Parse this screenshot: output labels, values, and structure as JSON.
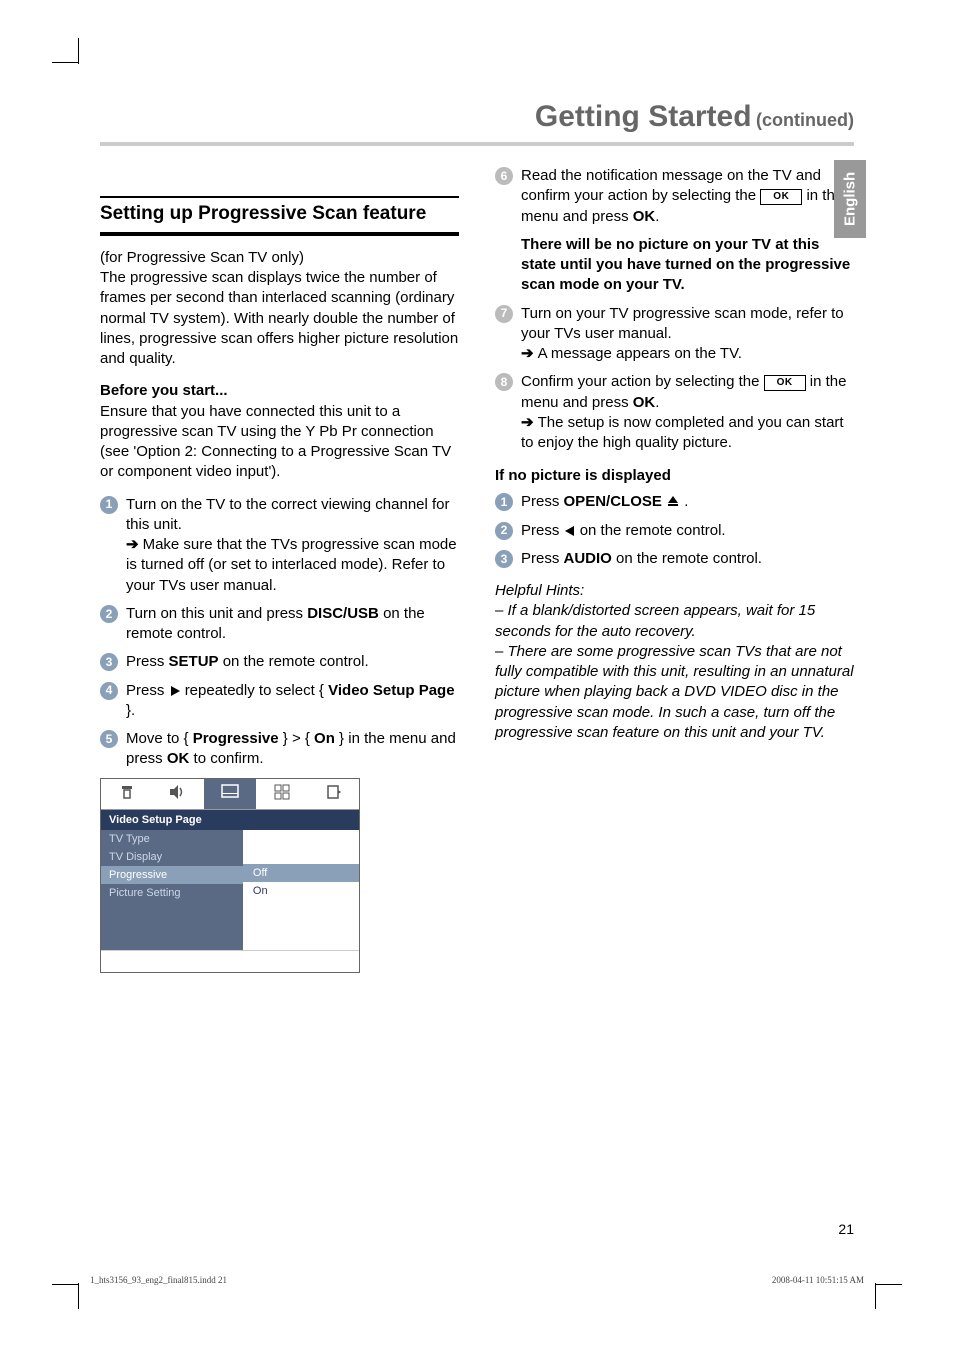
{
  "title": {
    "main": "Getting Started",
    "cont": "(continued)"
  },
  "side_tab": "English",
  "page_number": "21",
  "print": {
    "left": "1_hts3156_93_eng2_final815.indd   21",
    "right": "2008-04-11   10:51:15 AM"
  },
  "left": {
    "section_heading": "Setting up Progressive Scan feature",
    "intro": "(for Progressive Scan TV only)\nThe progressive scan displays twice the number of frames per second than interlaced scanning (ordinary normal TV system). With nearly double the number of lines, progressive scan offers higher picture resolution and quality.",
    "before_heading": "Before you start...",
    "before_body": "Ensure that you have connected this unit to a progressive scan TV using the Y Pb Pr connection (see 'Option 2: Connecting to a Progressive Scan TV or component video input').",
    "steps": {
      "s1a": "Turn on the TV to the correct viewing channel for this unit.",
      "s1b": "Make sure that the TVs progressive scan mode is turned off (or set to interlaced mode). Refer to your TVs user manual.",
      "s2a": "Turn on this unit and press ",
      "s2b": "DISC/USB",
      "s2c": " on the remote control.",
      "s3a": "Press ",
      "s3b": "SETUP",
      "s3c": " on the remote control.",
      "s4a": "Press ",
      "s4b": " repeatedly to select { ",
      "s4c": "Video Setup Page",
      "s4d": " }.",
      "s5a": "Move to { ",
      "s5b": "Progressive",
      "s5c": " } > { ",
      "s5d": "On",
      "s5e": " } in the menu and press ",
      "s5f": "OK",
      "s5g": " to confirm."
    },
    "osd": {
      "header": "Video Setup Page",
      "items": [
        "TV Type",
        "TV Display",
        "Progressive",
        "Picture Setting"
      ],
      "selected_index": 2,
      "options": [
        "Off",
        "On"
      ],
      "option_selected_index": 0
    }
  },
  "right": {
    "s6a": "Read the notification message on the TV and confirm your action by selecting the ",
    "s6b": "OK",
    "s6c": " in the menu and press ",
    "s6d": "OK",
    "s6e": ".",
    "bold_block": "There will be no picture on your TV at this state until you have turned on the progressive scan mode on your TV.",
    "s7a": "Turn on your TV progressive scan mode, refer to your TVs user manual.",
    "s7b": "A message appears on the TV.",
    "s8a": "Confirm your action by selecting the ",
    "s8b": "OK",
    "s8c": " in the menu and press ",
    "s8d": "OK",
    "s8e": ".",
    "s8f": "The setup is now completed and you can start to enjoy the high quality picture.",
    "nopic_heading": "If no picture is displayed",
    "np1a": "Press ",
    "np1b": "OPEN/CLOSE",
    "np1c": " .",
    "np2a": "Press ",
    "np2b": " on the remote control.",
    "np3a": "Press ",
    "np3b": "AUDIO",
    "np3c": " on the remote control.",
    "hints_heading": "Helpful Hints:",
    "hint1": "–  If a blank/distorted screen appears, wait for 15 seconds for the auto recovery.",
    "hint2": "–  There are some progressive scan TVs that are not fully compatible with this unit, resulting in an unnatural picture when playing back a DVD VIDEO disc in the progressive scan mode. In such a case, turn off the progressive scan feature on this unit and your TV."
  }
}
